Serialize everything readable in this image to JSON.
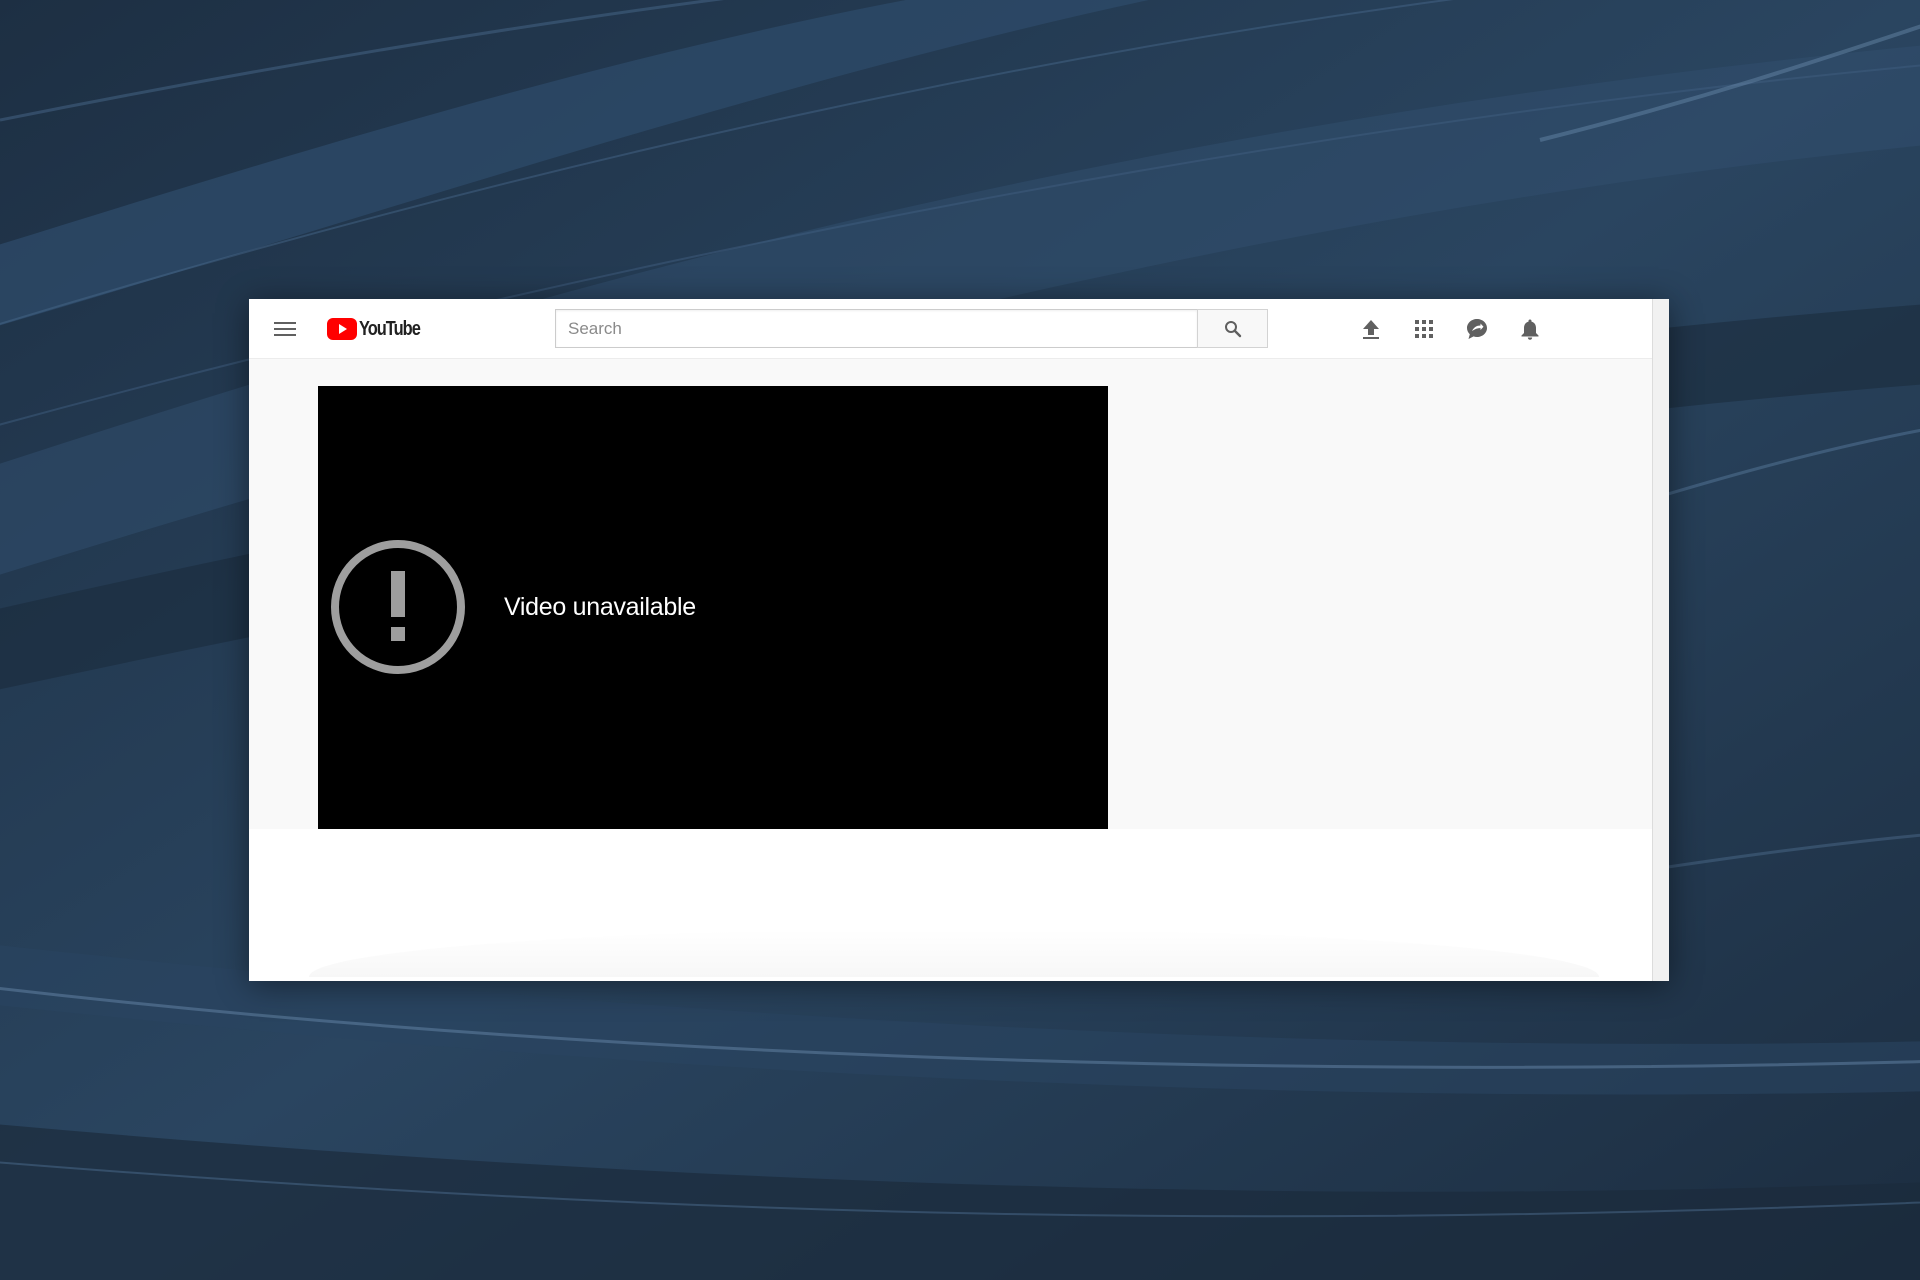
{
  "masthead": {
    "logo_text": "YouTube",
    "search_placeholder": "Search",
    "icons": [
      "menu-icon",
      "search-icon",
      "upload-icon",
      "apps-icon",
      "messages-icon",
      "notifications-icon"
    ]
  },
  "player": {
    "error_message": "Video unavailable",
    "error_icon": "alert-circle-icon"
  },
  "colors": {
    "brand_red": "#ff0000",
    "player_bg": "#000000",
    "page_bg": "#f9f9f9",
    "desktop_bg": "#22364d"
  }
}
